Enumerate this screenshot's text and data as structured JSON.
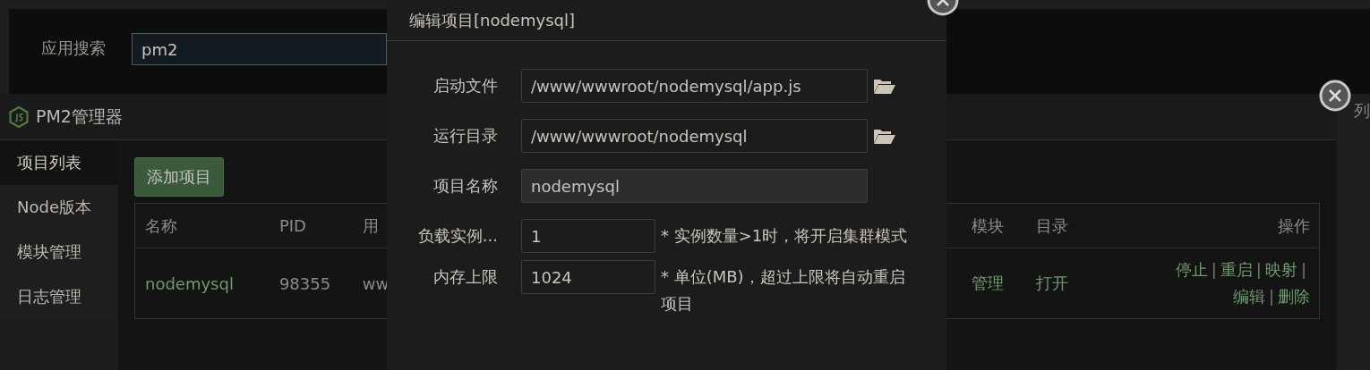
{
  "background_page": {
    "search_label": "应用搜索",
    "search_value": "pm2",
    "partial_text": "列"
  },
  "pm2_window": {
    "title": "PM2管理器",
    "sidebar": [
      {
        "label": "项目列表",
        "selected": true
      },
      {
        "label": "Node版本",
        "selected": false
      },
      {
        "label": "模块管理",
        "selected": false
      },
      {
        "label": "日志管理",
        "selected": false
      }
    ],
    "add_button": "添加项目",
    "table": {
      "columns": [
        "名称",
        "PID",
        "用",
        "模块",
        "目录",
        "操作"
      ],
      "rows": [
        {
          "name": "nodemysql",
          "pid": "98355",
          "user": "ww",
          "module": "管理",
          "directory": "打开",
          "actions": [
            "停止",
            "重启",
            "映射",
            "编辑",
            "删除"
          ],
          "separator": "|"
        }
      ]
    }
  },
  "dialog": {
    "title": "编辑项目[nodemysql]",
    "fields": [
      {
        "label": "启动文件",
        "value": "/www/wwwroot/nodemysql/app.js",
        "kind": "path"
      },
      {
        "label": "运行目录",
        "value": "/www/wwwroot/nodemysql",
        "kind": "path"
      },
      {
        "label": "项目名称",
        "value": "nodemysql",
        "kind": "readonly"
      },
      {
        "label": "负载实例...",
        "value": "1",
        "kind": "short",
        "note": "* 实例数量>1时，将开启集群模式"
      },
      {
        "label": "内存上限",
        "value": "1024",
        "kind": "short",
        "note": "* 单位(MB)，超过上限将自动重启项目"
      }
    ]
  }
}
